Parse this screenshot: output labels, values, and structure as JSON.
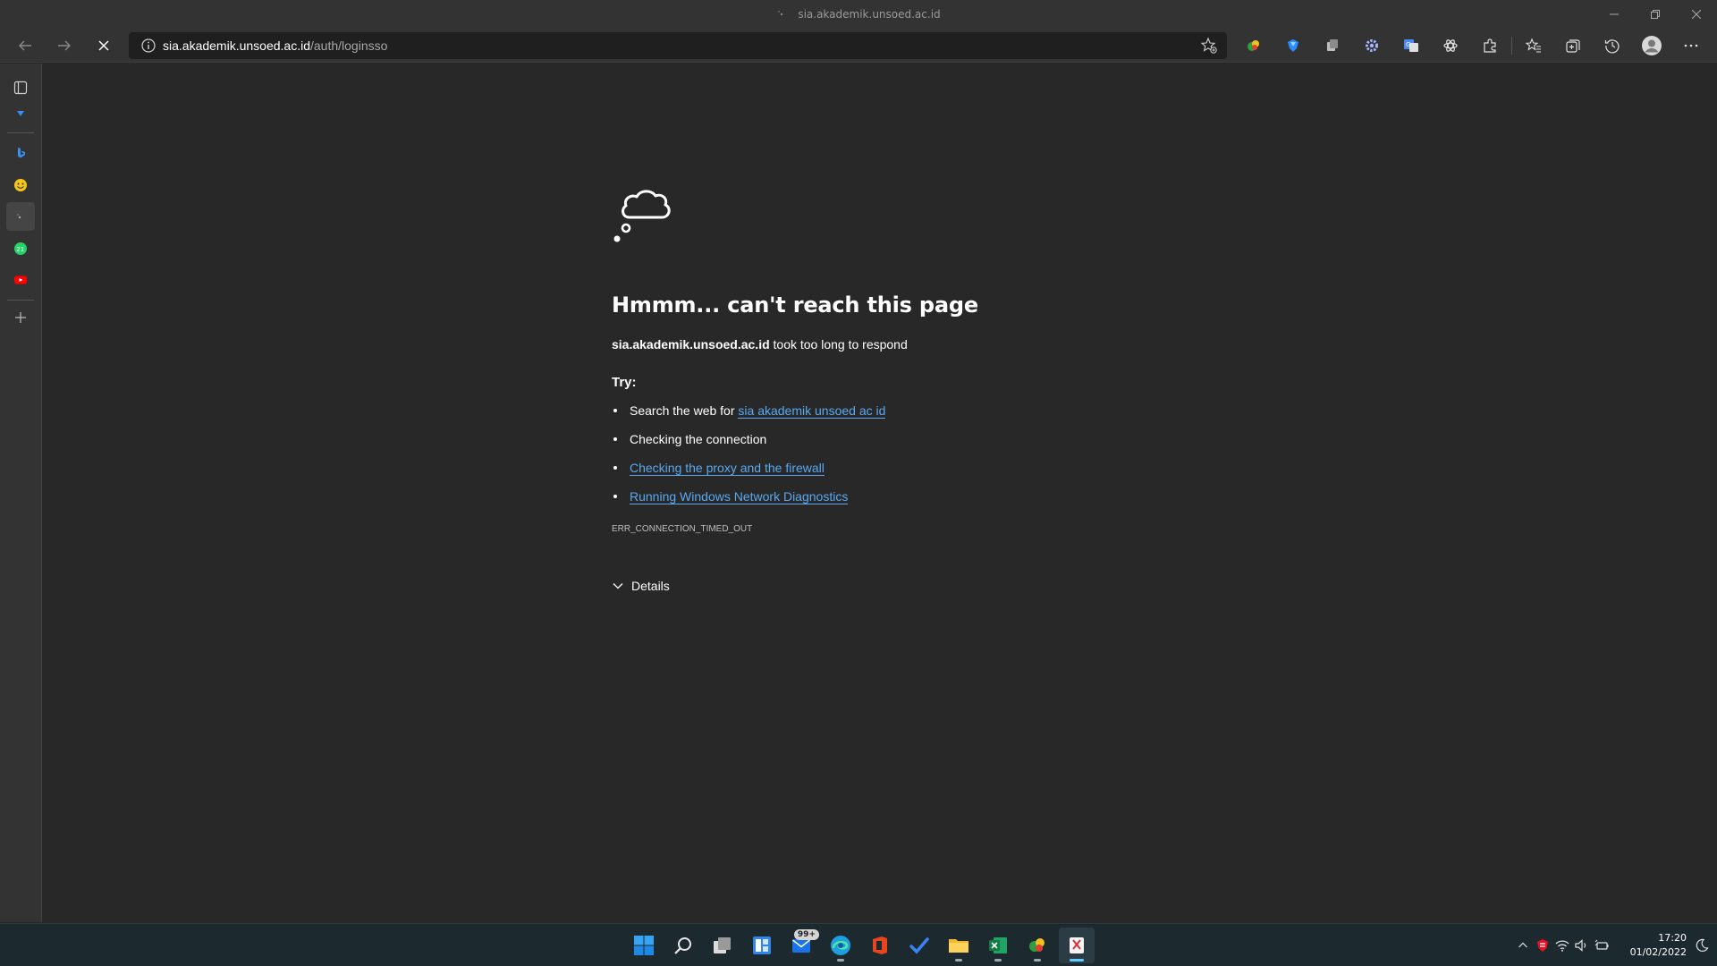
{
  "window": {
    "title": "sia.akademik.unsoed.ac.id"
  },
  "address_bar": {
    "host": "sia.akademik.unsoed.ac.id",
    "path": "/auth/loginsso"
  },
  "error_page": {
    "title": "Hmmm... can't reach this page",
    "host": "sia.akademik.unsoed.ac.id",
    "desc_suffix": " took too long to respond",
    "try_label": "Try:",
    "suggestions": {
      "search_prefix": "Search the web for ",
      "search_link": "sia akademik unsoed ac id",
      "connection": "Checking the connection",
      "proxy_link": "Checking the proxy and the firewall",
      "diagnostics_link": "Running Windows Network Diagnostics"
    },
    "error_code": "ERR_CONNECTION_TIMED_OUT",
    "details_label": "Details"
  },
  "taskbar": {
    "mail_badge": "99+",
    "clock_time": "17:20",
    "clock_date": "01/02/2022"
  },
  "colors": {
    "link": "#5aa9f0",
    "page_bg": "#282828",
    "chrome_bg": "#333333",
    "taskbar_bg": "#1c2a30"
  }
}
